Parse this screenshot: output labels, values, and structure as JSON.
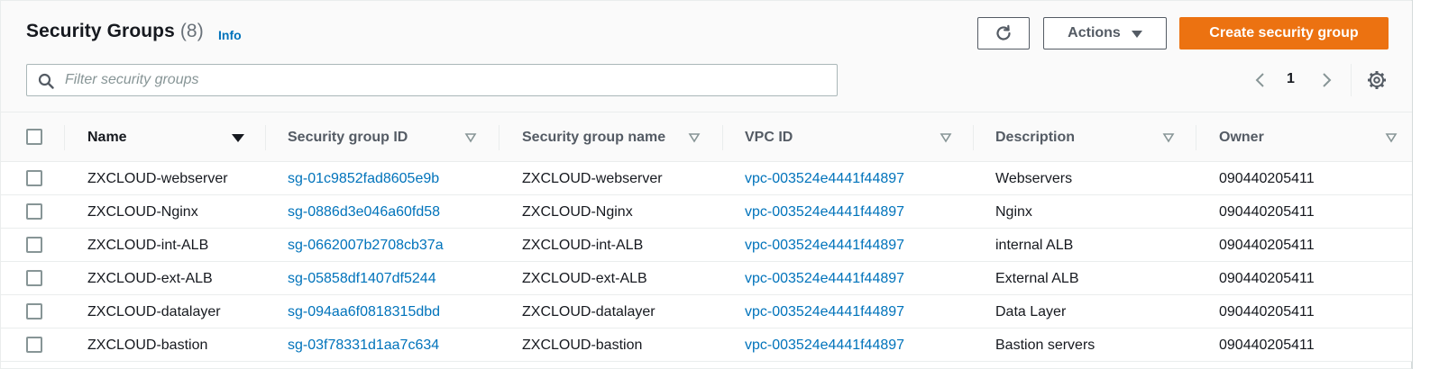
{
  "header": {
    "title": "Security Groups",
    "count": "(8)",
    "info_label": "Info",
    "actions_label": "Actions",
    "create_label": "Create security group",
    "refresh_icon": "refresh-icon"
  },
  "search": {
    "placeholder": "Filter security groups",
    "value": ""
  },
  "pagination": {
    "current_page": "1",
    "prev_icon": "chevron-left-icon",
    "next_icon": "chevron-right-icon",
    "settings_icon": "gear-icon"
  },
  "colors": {
    "accent_orange": "#ec7211",
    "link_blue": "#0073bb",
    "header_bg": "#fafafa",
    "border": "#eaeded",
    "muted_text": "#545b64"
  },
  "table": {
    "columns": [
      {
        "label": "Name",
        "sort": "descending"
      },
      {
        "label": "Security group ID",
        "sort": "none"
      },
      {
        "label": "Security group name",
        "sort": "none"
      },
      {
        "label": "VPC ID",
        "sort": "none"
      },
      {
        "label": "Description",
        "sort": "none"
      },
      {
        "label": "Owner",
        "sort": "none"
      }
    ],
    "rows": [
      {
        "name": "ZXCLOUD-webserver",
        "sg_id": "sg-01c9852fad8605e9b",
        "sg_name": "ZXCLOUD-webserver",
        "vpc_id": "vpc-003524e4441f44897",
        "description": "Webservers",
        "owner": "090440205411"
      },
      {
        "name": "ZXCLOUD-Nginx",
        "sg_id": "sg-0886d3e046a60fd58",
        "sg_name": "ZXCLOUD-Nginx",
        "vpc_id": "vpc-003524e4441f44897",
        "description": "Nginx",
        "owner": "090440205411"
      },
      {
        "name": "ZXCLOUD-int-ALB",
        "sg_id": "sg-0662007b2708cb37a",
        "sg_name": "ZXCLOUD-int-ALB",
        "vpc_id": "vpc-003524e4441f44897",
        "description": "internal ALB",
        "owner": "090440205411"
      },
      {
        "name": "ZXCLOUD-ext-ALB",
        "sg_id": "sg-05858df1407df5244",
        "sg_name": "ZXCLOUD-ext-ALB",
        "vpc_id": "vpc-003524e4441f44897",
        "description": "External ALB",
        "owner": "090440205411"
      },
      {
        "name": "ZXCLOUD-datalayer",
        "sg_id": "sg-094aa6f0818315dbd",
        "sg_name": "ZXCLOUD-datalayer",
        "vpc_id": "vpc-003524e4441f44897",
        "description": "Data Layer",
        "owner": "090440205411"
      },
      {
        "name": "ZXCLOUD-bastion",
        "sg_id": "sg-03f78331d1aa7c634",
        "sg_name": "ZXCLOUD-bastion",
        "vpc_id": "vpc-003524e4441f44897",
        "description": "Bastion servers",
        "owner": "090440205411"
      }
    ]
  }
}
